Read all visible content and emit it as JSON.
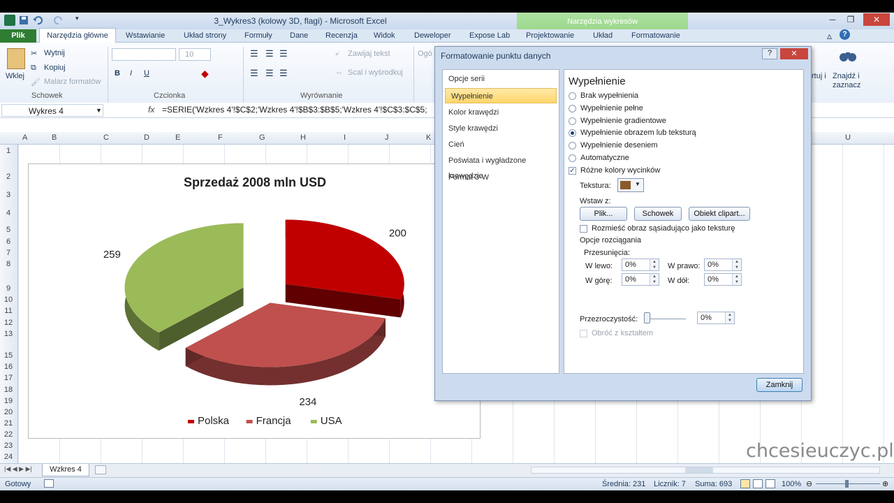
{
  "window": {
    "title": "3_Wykres3 (kolowy 3D, flagi) - Microsoft Excel",
    "contextual_group": "Narzędzia wykresów"
  },
  "ribbon": {
    "tabs": [
      "Plik",
      "Narzędzia główne",
      "Wstawianie",
      "Układ strony",
      "Formuły",
      "Dane",
      "Recenzja",
      "Widok",
      "Deweloper",
      "Expose Lab",
      "Projektowanie",
      "Układ",
      "Formatowanie"
    ],
    "clipboard": {
      "paste": "Wklej",
      "cut": "Wytnij",
      "copy": "Kopiuj",
      "format_painter": "Malarz formatów",
      "group": "Schowek"
    },
    "font": {
      "size": "10",
      "group": "Czcionka",
      "bold": "B",
      "italic": "I",
      "underline": "U"
    },
    "alignment": {
      "wrap": "Zawijaj tekst",
      "merge": "Scal i wyśrodkuj",
      "group": "Wyrównanie"
    },
    "editing": {
      "find": "Znajdź i",
      "select": "zaznacz"
    },
    "partial_left": "Ogó",
    "partial_right": "rtuj i"
  },
  "formula_bar": {
    "name_box": "Wykres 4",
    "fx": "fx",
    "formula": "=SERIE('Wzkres 4'!$C$2;'Wzkres 4'!$B$3:$B$5;'Wzkres 4'!$C$3:$C$5;"
  },
  "columns": [
    "A",
    "B",
    "C",
    "D",
    "E",
    "F",
    "G",
    "H",
    "I",
    "J",
    "K",
    "U"
  ],
  "rows": [
    "1",
    "2",
    "3",
    "4",
    "5",
    "6",
    "7",
    "8",
    "9",
    "10",
    "11",
    "12",
    "13",
    "15",
    "16",
    "17",
    "18",
    "19",
    "20",
    "21",
    "22",
    "23",
    "24"
  ],
  "chart_data": {
    "type": "pie",
    "title": "Sprzedaż 2008 mln USD",
    "categories": [
      "Polska",
      "Francja",
      "USA"
    ],
    "values": [
      200,
      234,
      259
    ],
    "colors": [
      "#c00000",
      "#c0504d",
      "#9bbb59"
    ],
    "legend": "bottom",
    "style": "3D exploded"
  },
  "dialog": {
    "title": "Formatowanie punktu danych",
    "help": "?",
    "close": "✕",
    "nav": [
      "Opcje serii",
      "Wypełnienie",
      "Kolor krawędzi",
      "Style krawędzi",
      "Cień",
      "Poświata i wygładzone krawędzie",
      "Format 3-W"
    ],
    "section_title": "Wypełnienie",
    "fill_options": [
      "Brak wypełnienia",
      "Wypełnienie pełne",
      "Wypełnienie gradientowe",
      "Wypełnienie obrazem lub teksturą",
      "Wypełnienie deseniem",
      "Automatyczne"
    ],
    "vary_colors": "Różne kolory wycinków",
    "texture_label": "Tekstura:",
    "insert_from": "Wstaw z:",
    "btn_file": "Plik...",
    "btn_clipboard": "Schowek",
    "btn_clipart": "Obiekt clipart...",
    "tile": "Rozmieść obraz sąsiadująco jako teksturę",
    "stretch_options": "Opcje rozciągania",
    "offsets": "Przesunięcia:",
    "left": "W lewo:",
    "right": "W prawo:",
    "top": "W górę:",
    "bottom": "W dół:",
    "offset_value": "0%",
    "transparency": "Przezroczystość:",
    "transparency_value": "0%",
    "rotate": "Obróć z kształtem",
    "close_button": "Zamknij"
  },
  "sheet_tab": "Wzkres 4",
  "status": {
    "ready": "Gotowy",
    "average": "Średnia: 231",
    "count": "Licznik: 7",
    "sum": "Suma: 693",
    "zoom": "100%"
  },
  "watermark": "chcesieuczyc.pl"
}
